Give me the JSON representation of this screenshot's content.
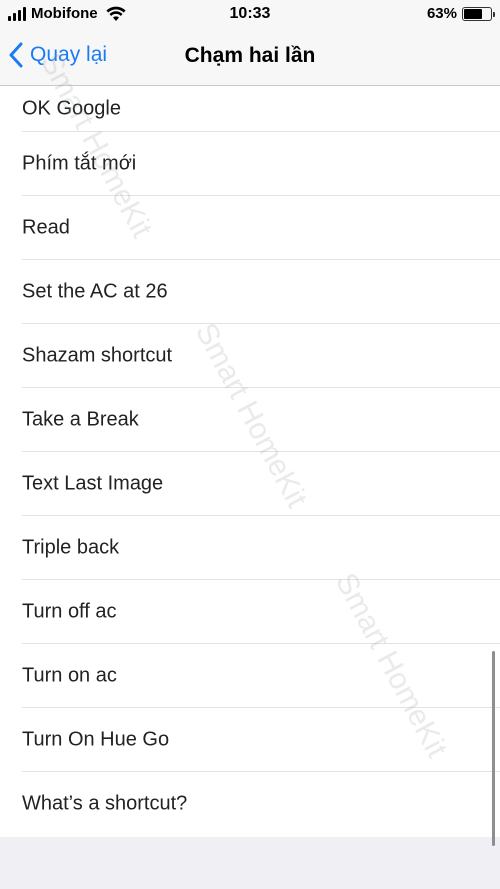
{
  "status_bar": {
    "carrier": "Mobifone",
    "time": "10:33",
    "battery_percent": "63%",
    "battery_level": 0.63,
    "signal_icon": "signal-bars-icon",
    "wifi_icon": "wifi-icon",
    "battery_icon": "battery-icon"
  },
  "nav": {
    "back_label": "Quay lại",
    "back_icon": "chevron-left-icon",
    "title": "Chạm hai lần",
    "accent_color": "#1a7cf5"
  },
  "list": {
    "items": [
      {
        "label": "OK Google"
      },
      {
        "label": "Phím tắt mới"
      },
      {
        "label": "Read"
      },
      {
        "label": "Set the AC at 26"
      },
      {
        "label": "Shazam shortcut"
      },
      {
        "label": "Take a Break"
      },
      {
        "label": "Text Last Image"
      },
      {
        "label": "Triple back"
      },
      {
        "label": "Turn off ac"
      },
      {
        "label": "Turn on ac"
      },
      {
        "label": "Turn On Hue Go"
      },
      {
        "label": "What’s a shortcut?"
      }
    ]
  },
  "watermark": {
    "text": "Smart HomeKit"
  }
}
